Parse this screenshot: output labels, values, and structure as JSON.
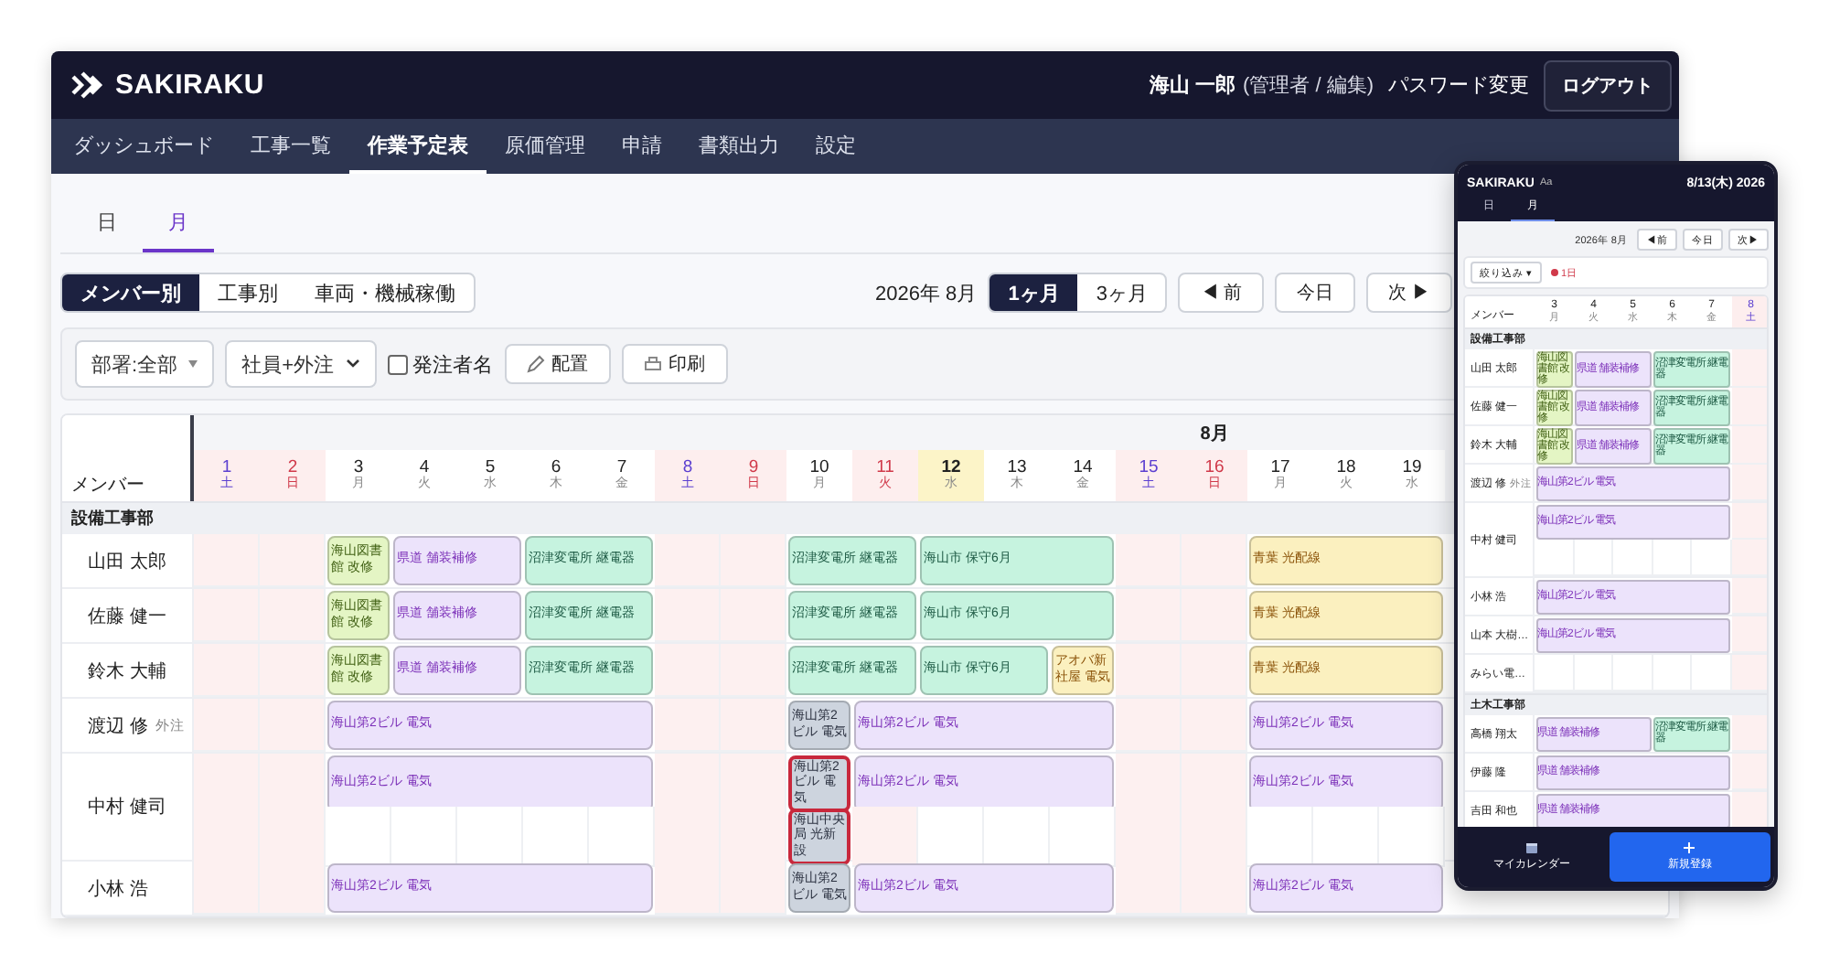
{
  "header": {
    "brand": "SAKIRAKU",
    "user": "海山 一郎",
    "role": "(管理者 / 編集)",
    "password_link": "パスワード変更",
    "logout": "ログアウト"
  },
  "nav": [
    {
      "label": "ダッシュボード",
      "selected": false
    },
    {
      "label": "工事一覧",
      "selected": false
    },
    {
      "label": "作業予定表",
      "selected": true
    },
    {
      "label": "原価管理",
      "selected": false
    },
    {
      "label": "申請",
      "selected": false
    },
    {
      "label": "書類出力",
      "selected": false
    },
    {
      "label": "設定",
      "selected": false
    }
  ],
  "period_tabs": [
    {
      "label": "日",
      "selected": false
    },
    {
      "label": "月",
      "selected": true
    }
  ],
  "toolbar": {
    "views": [
      {
        "label": "メンバー別",
        "selected": true
      },
      {
        "label": "工事別",
        "selected": false
      },
      {
        "label": "車両・機械稼働",
        "selected": false
      }
    ],
    "month_label": "2026年 8月",
    "ranges": [
      {
        "label": "1ヶ月",
        "selected": true
      },
      {
        "label": "3ヶ月",
        "selected": false
      }
    ],
    "nav_buttons": [
      "◀ 前",
      "今日",
      "次 ▶"
    ]
  },
  "filters": [
    {
      "kind": "select",
      "label": "部署:全部"
    },
    {
      "kind": "dropdown",
      "label": "社員+外注"
    },
    {
      "kind": "checkbox",
      "label": "発注者名",
      "checked": false
    },
    {
      "kind": "pen_button",
      "label": "配置"
    },
    {
      "kind": "print_button",
      "label": "印刷"
    }
  ],
  "calendar": {
    "member_header": "メンバー",
    "month_label": "8月",
    "days": [
      {
        "day": "1",
        "weekday": "土",
        "kind": "sat"
      },
      {
        "day": "2",
        "weekday": "日",
        "kind": "sun"
      },
      {
        "day": "3",
        "weekday": "月",
        "kind": "weekday"
      },
      {
        "day": "4",
        "weekday": "火",
        "kind": "weekday"
      },
      {
        "day": "5",
        "weekday": "水",
        "kind": "weekday"
      },
      {
        "day": "6",
        "weekday": "木",
        "kind": "weekday"
      },
      {
        "day": "7",
        "weekday": "金",
        "kind": "weekday"
      },
      {
        "day": "8",
        "weekday": "土",
        "kind": "sat"
      },
      {
        "day": "9",
        "weekday": "日",
        "kind": "sun"
      },
      {
        "day": "10",
        "weekday": "月",
        "kind": "weekday"
      },
      {
        "day": "11",
        "weekday": "火",
        "kind": "holiday"
      },
      {
        "day": "12",
        "weekday": "水",
        "kind": "today"
      },
      {
        "day": "13",
        "weekday": "木",
        "kind": "weekday"
      },
      {
        "day": "14",
        "weekday": "金",
        "kind": "weekday"
      },
      {
        "day": "15",
        "weekday": "土",
        "kind": "sat"
      },
      {
        "day": "16",
        "weekday": "日",
        "kind": "sun"
      },
      {
        "day": "17",
        "weekday": "月",
        "kind": "weekday"
      },
      {
        "day": "18",
        "weekday": "火",
        "kind": "weekday"
      },
      {
        "day": "19",
        "weekday": "水",
        "kind": "weekday"
      }
    ],
    "departments": [
      {
        "name": "設備工事部",
        "members": [
          {
            "name": "山田 太郎",
            "lanes": [
              [
                {
                  "kind": "free"
                },
                {
                  "kind": "free"
                },
                {
                  "kind": "event",
                  "label": "海山図書館 改修",
                  "color": "#e4f5c4",
                  "conflict": false
                },
                {
                  "kind": "event",
                  "label": "県道 舗装補修",
                  "color": "#ece3fb",
                  "conflict": false
                },
                {
                  "kind": "cont"
                },
                {
                  "kind": "event",
                  "label": "沼津変電所 継電器",
                  "color": "#c6f3df",
                  "conflict": false
                },
                {
                  "kind": "cont"
                },
                {
                  "kind": "free"
                },
                {
                  "kind": "free"
                },
                {
                  "kind": "event",
                  "label": "沼津変電所 継電器",
                  "color": "#c6f3df",
                  "conflict": false
                },
                {
                  "kind": "cont"
                },
                {
                  "kind": "event",
                  "label": "海山市 保守6月",
                  "color": "#c6f3df",
                  "conflict": false
                },
                {
                  "kind": "cont"
                },
                {
                  "kind": "cont"
                },
                {
                  "kind": "free"
                },
                {
                  "kind": "free"
                },
                {
                  "kind": "event",
                  "label": "青葉 光配線",
                  "color": "#fbf0bf",
                  "conflict": false
                },
                {
                  "kind": "cont"
                },
                {
                  "kind": "cont"
                }
              ]
            ]
          },
          {
            "name": "佐藤 健一",
            "lanes": [
              [
                {
                  "kind": "free"
                },
                {
                  "kind": "free"
                },
                {
                  "kind": "event",
                  "label": "海山図書館 改修",
                  "color": "#e4f5c4",
                  "conflict": false
                },
                {
                  "kind": "event",
                  "label": "県道 舗装補修",
                  "color": "#ece3fb",
                  "conflict": false
                },
                {
                  "kind": "cont"
                },
                {
                  "kind": "event",
                  "label": "沼津変電所 継電器",
                  "color": "#c6f3df",
                  "conflict": false
                },
                {
                  "kind": "cont"
                },
                {
                  "kind": "free"
                },
                {
                  "kind": "free"
                },
                {
                  "kind": "event",
                  "label": "沼津変電所 継電器",
                  "color": "#c6f3df",
                  "conflict": false
                },
                {
                  "kind": "cont"
                },
                {
                  "kind": "event",
                  "label": "海山市 保守6月",
                  "color": "#c6f3df",
                  "conflict": false
                },
                {
                  "kind": "cont"
                },
                {
                  "kind": "cont"
                },
                {
                  "kind": "free"
                },
                {
                  "kind": "free"
                },
                {
                  "kind": "event",
                  "label": "青葉 光配線",
                  "color": "#fbf0bf",
                  "conflict": false
                },
                {
                  "kind": "cont"
                },
                {
                  "kind": "cont"
                }
              ]
            ]
          },
          {
            "name": "鈴木 大輔",
            "lanes": [
              [
                {
                  "kind": "free"
                },
                {
                  "kind": "free"
                },
                {
                  "kind": "event",
                  "label": "海山図書館 改修",
                  "color": "#e4f5c4",
                  "conflict": false
                },
                {
                  "kind": "event",
                  "label": "県道 舗装補修",
                  "color": "#ece3fb",
                  "conflict": false
                },
                {
                  "kind": "cont"
                },
                {
                  "kind": "event",
                  "label": "沼津変電所 継電器",
                  "color": "#c6f3df",
                  "conflict": false
                },
                {
                  "kind": "cont"
                },
                {
                  "kind": "free"
                },
                {
                  "kind": "free"
                },
                {
                  "kind": "event",
                  "label": "沼津変電所 継電器",
                  "color": "#c6f3df",
                  "conflict": false
                },
                {
                  "kind": "cont"
                },
                {
                  "kind": "event",
                  "label": "海山市 保守6月",
                  "color": "#c6f3df",
                  "conflict": false
                },
                {
                  "kind": "cont"
                },
                {
                  "kind": "event",
                  "label": "アオバ新社屋 電気",
                  "color": "#fbf0bf",
                  "conflict": false
                },
                {
                  "kind": "free"
                },
                {
                  "kind": "free"
                },
                {
                  "kind": "event",
                  "label": "青葉 光配線",
                  "color": "#fbf0bf",
                  "conflict": false
                },
                {
                  "kind": "cont"
                },
                {
                  "kind": "cont"
                }
              ]
            ]
          },
          {
            "name": "渡辺 修",
            "tag": "外注",
            "lanes": [
              [
                {
                  "kind": "free"
                },
                {
                  "kind": "free"
                },
                {
                  "kind": "event",
                  "label": "海山第2ビル 電気",
                  "color": "#ece3fb",
                  "conflict": false
                },
                {
                  "kind": "cont"
                },
                {
                  "kind": "cont"
                },
                {
                  "kind": "cont"
                },
                {
                  "kind": "cont"
                },
                {
                  "kind": "free"
                },
                {
                  "kind": "free"
                },
                {
                  "kind": "event",
                  "label": "海山第2ビル 電気",
                  "color": "#cdd4de",
                  "conflict": false
                },
                {
                  "kind": "event",
                  "label": "海山第2ビル 電気",
                  "color": "#ece3fb",
                  "conflict": false
                },
                {
                  "kind": "cont"
                },
                {
                  "kind": "cont"
                },
                {
                  "kind": "cont"
                },
                {
                  "kind": "free"
                },
                {
                  "kind": "free"
                },
                {
                  "kind": "event",
                  "label": "海山第2ビル 電気",
                  "color": "#ece3fb",
                  "conflict": false
                },
                {
                  "kind": "cont"
                },
                {
                  "kind": "cont"
                }
              ]
            ]
          },
          {
            "name": "中村 健司",
            "lanes": [
              [
                {
                  "kind": "free"
                },
                {
                  "kind": "free"
                },
                {
                  "kind": "event",
                  "label": "海山第2ビル 電気",
                  "color": "#ece3fb",
                  "conflict": false
                },
                {
                  "kind": "cont"
                },
                {
                  "kind": "cont"
                },
                {
                  "kind": "cont"
                },
                {
                  "kind": "cont"
                },
                {
                  "kind": "free"
                },
                {
                  "kind": "free"
                },
                {
                  "kind": "event",
                  "label": "海山第2ビル 電気",
                  "color": "#cdd4de",
                  "conflict": true
                },
                {
                  "kind": "event",
                  "label": "海山第2ビル 電気",
                  "color": "#ece3fb",
                  "conflict": false
                },
                {
                  "kind": "cont"
                },
                {
                  "kind": "cont"
                },
                {
                  "kind": "cont"
                },
                {
                  "kind": "free"
                },
                {
                  "kind": "free"
                },
                {
                  "kind": "event",
                  "label": "海山第2ビル 電気",
                  "color": "#ece3fb",
                  "conflict": false
                },
                {
                  "kind": "cont"
                },
                {
                  "kind": "cont"
                }
              ],
              [
                {
                  "kind": "free"
                },
                {
                  "kind": "free"
                },
                {
                  "kind": "free"
                },
                {
                  "kind": "free"
                },
                {
                  "kind": "free"
                },
                {
                  "kind": "free"
                },
                {
                  "kind": "free"
                },
                {
                  "kind": "free"
                },
                {
                  "kind": "free"
                },
                {
                  "kind": "event",
                  "label": "海山中央局 光新設",
                  "color": "#cdd4de",
                  "conflict": true
                },
                {
                  "kind": "free"
                },
                {
                  "kind": "free"
                },
                {
                  "kind": "free"
                },
                {
                  "kind": "free"
                },
                {
                  "kind": "free"
                },
                {
                  "kind": "free"
                },
                {
                  "kind": "free"
                },
                {
                  "kind": "free"
                },
                {
                  "kind": "free"
                }
              ]
            ]
          },
          {
            "name": "小林 浩",
            "lanes": [
              [
                {
                  "kind": "free"
                },
                {
                  "kind": "free"
                },
                {
                  "kind": "event",
                  "label": "海山第2ビル 電気",
                  "color": "#ece3fb",
                  "conflict": false
                },
                {
                  "kind": "cont"
                },
                {
                  "kind": "cont"
                },
                {
                  "kind": "cont"
                },
                {
                  "kind": "cont"
                },
                {
                  "kind": "free"
                },
                {
                  "kind": "free"
                },
                {
                  "kind": "event",
                  "label": "海山第2ビル 電気",
                  "color": "#cdd4de",
                  "conflict": false
                },
                {
                  "kind": "event",
                  "label": "海山第2ビル 電気",
                  "color": "#ece3fb",
                  "conflict": false
                },
                {
                  "kind": "cont"
                },
                {
                  "kind": "cont"
                },
                {
                  "kind": "cont"
                },
                {
                  "kind": "free"
                },
                {
                  "kind": "free"
                },
                {
                  "kind": "event",
                  "label": "海山第2ビル 電気",
                  "color": "#ece3fb",
                  "conflict": false
                },
                {
                  "kind": "cont"
                },
                {
                  "kind": "cont"
                }
              ]
            ]
          }
        ]
      }
    ]
  },
  "mobile": {
    "brand": "SAKIRAKU",
    "font_size": "Aa",
    "date": "8/13(木) 2026",
    "tabs": [
      {
        "label": "日",
        "selected": false
      },
      {
        "label": "月",
        "selected": true
      }
    ],
    "month_label": "2026年 8月",
    "nav_buttons": [
      "◀前",
      "今日",
      "次▶"
    ],
    "filter_button": "絞り込み ▾",
    "alert": "1日",
    "calendar": {
      "member_header": "メンバー",
      "days": [
        {
          "day": "3",
          "weekday": "月",
          "kind": "weekday"
        },
        {
          "day": "4",
          "weekday": "火",
          "kind": "weekday"
        },
        {
          "day": "5",
          "weekday": "水",
          "kind": "weekday"
        },
        {
          "day": "6",
          "weekday": "木",
          "kind": "weekday"
        },
        {
          "day": "7",
          "weekday": "金",
          "kind": "weekday"
        },
        {
          "day": "8",
          "weekday": "土",
          "kind": "sat"
        }
      ],
      "departments": [
        {
          "name": "設備工事部",
          "members": [
            {
              "name": "山田 太郎",
              "lanes": [
                [
                  {
                    "kind": "event",
                    "label": "海山図書館 改修",
                    "color": "#e4f5c4",
                    "conflict": false
                  },
                  {
                    "kind": "event",
                    "label": "県道 舗装補修",
                    "color": "#ece3fb",
                    "conflict": false
                  },
                  {
                    "kind": "cont"
                  },
                  {
                    "kind": "event",
                    "label": "沼津変電所 継電器",
                    "color": "#c6f3df",
                    "conflict": false
                  },
                  {
                    "kind": "cont"
                  },
                  {
                    "kind": "free"
                  }
                ]
              ]
            },
            {
              "name": "佐藤 健一",
              "lanes": [
                [
                  {
                    "kind": "event",
                    "label": "海山図書館 改修",
                    "color": "#e4f5c4",
                    "conflict": false
                  },
                  {
                    "kind": "event",
                    "label": "県道 舗装補修",
                    "color": "#ece3fb",
                    "conflict": false
                  },
                  {
                    "kind": "cont"
                  },
                  {
                    "kind": "event",
                    "label": "沼津変電所 継電器",
                    "color": "#c6f3df",
                    "conflict": false
                  },
                  {
                    "kind": "cont"
                  },
                  {
                    "kind": "free"
                  }
                ]
              ]
            },
            {
              "name": "鈴木 大輔",
              "lanes": [
                [
                  {
                    "kind": "event",
                    "label": "海山図書館 改修",
                    "color": "#e4f5c4",
                    "conflict": false
                  },
                  {
                    "kind": "event",
                    "label": "県道 舗装補修",
                    "color": "#ece3fb",
                    "conflict": false
                  },
                  {
                    "kind": "cont"
                  },
                  {
                    "kind": "event",
                    "label": "沼津変電所 継電器",
                    "color": "#c6f3df",
                    "conflict": false
                  },
                  {
                    "kind": "cont"
                  },
                  {
                    "kind": "free"
                  }
                ]
              ]
            },
            {
              "name": "渡辺 修",
              "tag": "外注",
              "lanes": [
                [
                  {
                    "kind": "event",
                    "label": "海山第2ビル 電気",
                    "color": "#ece3fb",
                    "conflict": false
                  },
                  {
                    "kind": "cont"
                  },
                  {
                    "kind": "cont"
                  },
                  {
                    "kind": "cont"
                  },
                  {
                    "kind": "cont"
                  },
                  {
                    "kind": "free"
                  }
                ]
              ]
            },
            {
              "name": "中村 健司",
              "lanes": [
                [
                  {
                    "kind": "event",
                    "label": "海山第2ビル 電気",
                    "color": "#ece3fb",
                    "conflict": false
                  },
                  {
                    "kind": "cont"
                  },
                  {
                    "kind": "cont"
                  },
                  {
                    "kind": "cont"
                  },
                  {
                    "kind": "cont"
                  },
                  {
                    "kind": "free"
                  }
                ],
                [
                  {
                    "kind": "free"
                  },
                  {
                    "kind": "free"
                  },
                  {
                    "kind": "free"
                  },
                  {
                    "kind": "free"
                  },
                  {
                    "kind": "free"
                  },
                  {
                    "kind": "free"
                  }
                ]
              ]
            },
            {
              "name": "小林 浩",
              "lanes": [
                [
                  {
                    "kind": "event",
                    "label": "海山第2ビル 電気",
                    "color": "#ece3fb",
                    "conflict": false
                  },
                  {
                    "kind": "cont"
                  },
                  {
                    "kind": "cont"
                  },
                  {
                    "kind": "cont"
                  },
                  {
                    "kind": "cont"
                  },
                  {
                    "kind": "free"
                  }
                ]
              ]
            },
            {
              "name": "山本 大樹…",
              "lanes": [
                [
                  {
                    "kind": "event",
                    "label": "海山第2ビル 電気",
                    "color": "#ece3fb",
                    "conflict": false
                  },
                  {
                    "kind": "cont"
                  },
                  {
                    "kind": "cont"
                  },
                  {
                    "kind": "cont"
                  },
                  {
                    "kind": "cont"
                  },
                  {
                    "kind": "free"
                  }
                ]
              ]
            },
            {
              "name": "みらい電…",
              "lanes": [
                [
                  {
                    "kind": "free"
                  },
                  {
                    "kind": "free"
                  },
                  {
                    "kind": "free"
                  },
                  {
                    "kind": "free"
                  },
                  {
                    "kind": "free"
                  },
                  {
                    "kind": "free"
                  }
                ]
              ]
            }
          ]
        },
        {
          "name": "土木工事部",
          "members": [
            {
              "name": "高橋 翔太",
              "lanes": [
                [
                  {
                    "kind": "event",
                    "label": "県道 舗装補修",
                    "color": "#ece3fb",
                    "conflict": false
                  },
                  {
                    "kind": "cont"
                  },
                  {
                    "kind": "cont"
                  },
                  {
                    "kind": "event",
                    "label": "沼津変電所 継電器",
                    "color": "#c6f3df",
                    "conflict": false
                  },
                  {
                    "kind": "cont"
                  },
                  {
                    "kind": "free"
                  }
                ]
              ]
            },
            {
              "name": "伊藤 隆",
              "lanes": [
                [
                  {
                    "kind": "event",
                    "label": "県道 舗装補修",
                    "color": "#ece3fb",
                    "conflict": false
                  },
                  {
                    "kind": "cont"
                  },
                  {
                    "kind": "cont"
                  },
                  {
                    "kind": "cont"
                  },
                  {
                    "kind": "cont"
                  },
                  {
                    "kind": "free"
                  }
                ]
              ]
            },
            {
              "name": "吉田 和也",
              "lanes": [
                [
                  {
                    "kind": "event",
                    "label": "県道 舗装補修",
                    "color": "#ece3fb",
                    "conflict": false
                  },
                  {
                    "kind": "cont"
                  },
                  {
                    "kind": "cont"
                  },
                  {
                    "kind": "cont"
                  },
                  {
                    "kind": "cont"
                  },
                  {
                    "kind": "free"
                  }
                ]
              ]
            }
          ]
        }
      ]
    },
    "bottom_bar": {
      "calendar_label": "マイカレンダー",
      "new_label": "新規登録"
    }
  }
}
